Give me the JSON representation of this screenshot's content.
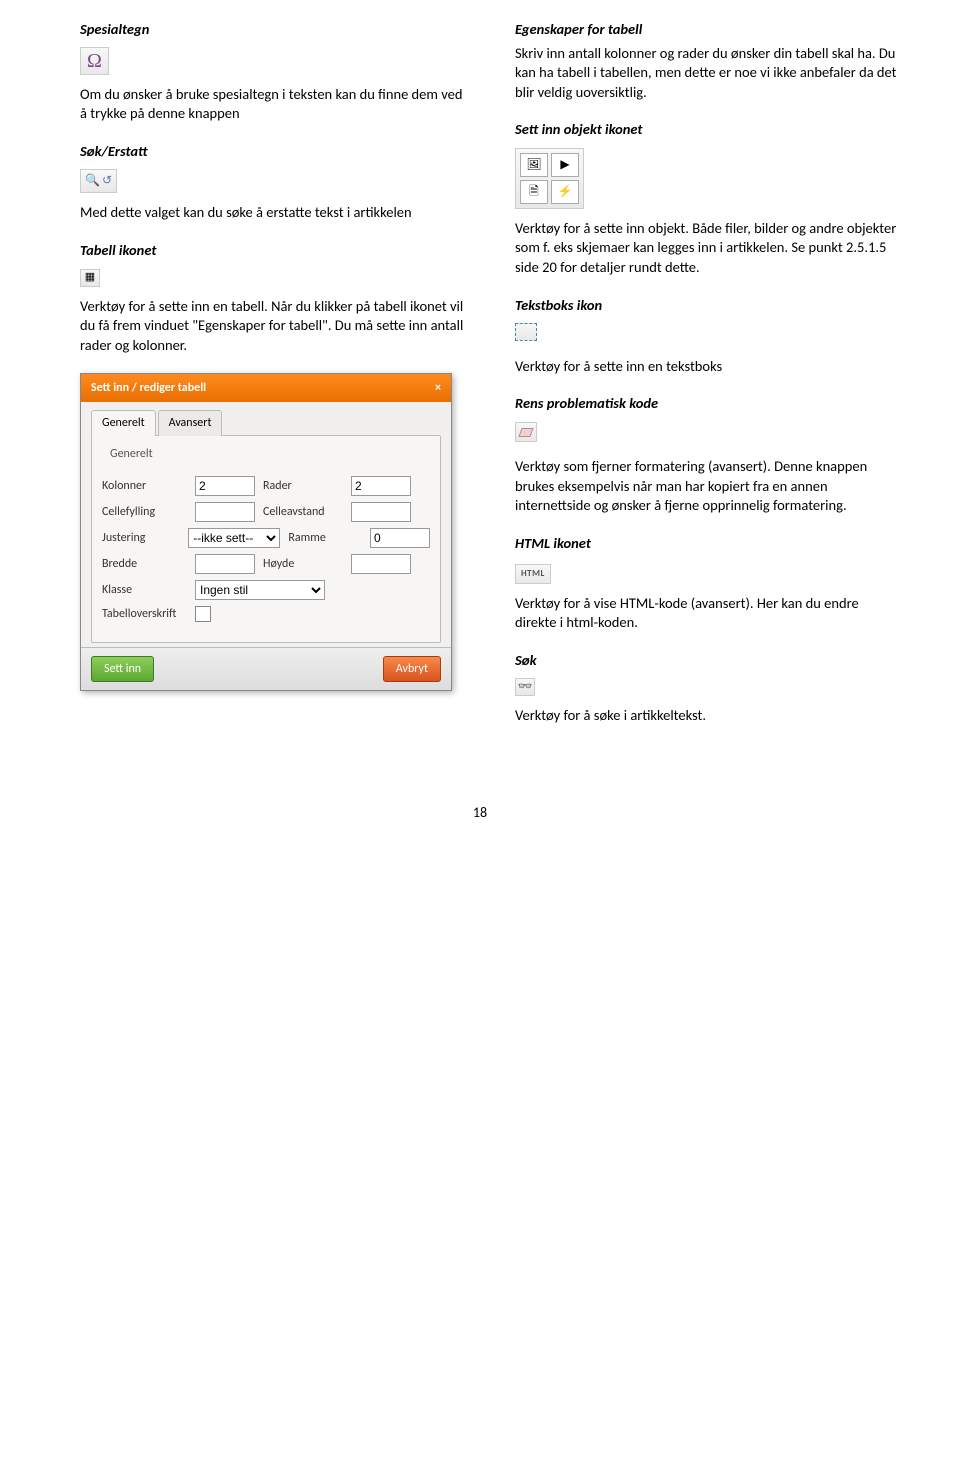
{
  "left": {
    "sec1": {
      "title": "Spesialtegn",
      "icon_name": "omega-icon",
      "icon_glyph": "Ω",
      "text": "Om du ønsker å bruke spesialtegn i teksten kan du finne dem ved å trykke på denne knappen"
    },
    "sec2": {
      "title": "Søk/Erstatt",
      "text": "Med dette valget kan du søke å erstatte tekst i artikkelen"
    },
    "sec3": {
      "title": "Tabell ikonet",
      "text": "Verktøy for å sette inn en tabell. Når du klikker på tabell ikonet vil du få frem vinduet \"Egenskaper for tabell\". Du må sette inn antall rader og kolonner."
    },
    "dialog": {
      "title": "Sett inn / rediger tabell",
      "close": "×",
      "tab1": "Generelt",
      "tab2": "Avansert",
      "legend": "Generelt",
      "kolonner_label": "Kolonner",
      "kolonner_val": "2",
      "rader_label": "Rader",
      "rader_val": "2",
      "cellefyll_label": "Cellefylling",
      "celleavst_label": "Celleavstand",
      "justering_label": "Justering",
      "justering_val": "--ikke sett--",
      "ramme_label": "Ramme",
      "ramme_val": "0",
      "bredde_label": "Bredde",
      "hoyde_label": "Høyde",
      "klasse_label": "Klasse",
      "klasse_val": "Ingen stil",
      "overskrift_label": "Tabelloverskrift",
      "btn_ok": "Sett inn",
      "btn_cancel": "Avbryt"
    }
  },
  "right": {
    "sec1": {
      "title": "Egenskaper for tabell",
      "text": "Skriv inn antall kolonner og rader du ønsker din tabell skal ha. Du kan ha tabell i tabellen, men dette er noe vi ikke anbefaler da det blir veldig uoversiktlig."
    },
    "sec2": {
      "title": "Sett inn objekt ikonet"
    },
    "sec3": {
      "text": "Verktøy for å sette inn objekt. Både filer, bilder og andre objekter som f. eks skjemaer kan legges inn i artikkelen. Se punkt 2.5.1.5 side 20 for detaljer rundt dette."
    },
    "sec4": {
      "title": "Tekstboks ikon",
      "text": "Verktøy for å sette inn en tekstboks"
    },
    "sec5": {
      "title": "Rens problematisk kode"
    },
    "sec6": {
      "text": "Verktøy som fjerner formatering (avansert). Denne knappen brukes eksempelvis når man har kopiert fra en annen internettside og ønsker å fjerne opprinnelig formatering."
    },
    "sec7": {
      "title": "HTML ikonet",
      "btn": "HTML",
      "text": "Verktøy for å vise HTML-kode (avansert). Her kan du endre direkte i html-koden."
    },
    "sec8": {
      "title": "Søk",
      "text": "Verktøy for å søke i artikkeltekst."
    }
  },
  "page_number": "18"
}
